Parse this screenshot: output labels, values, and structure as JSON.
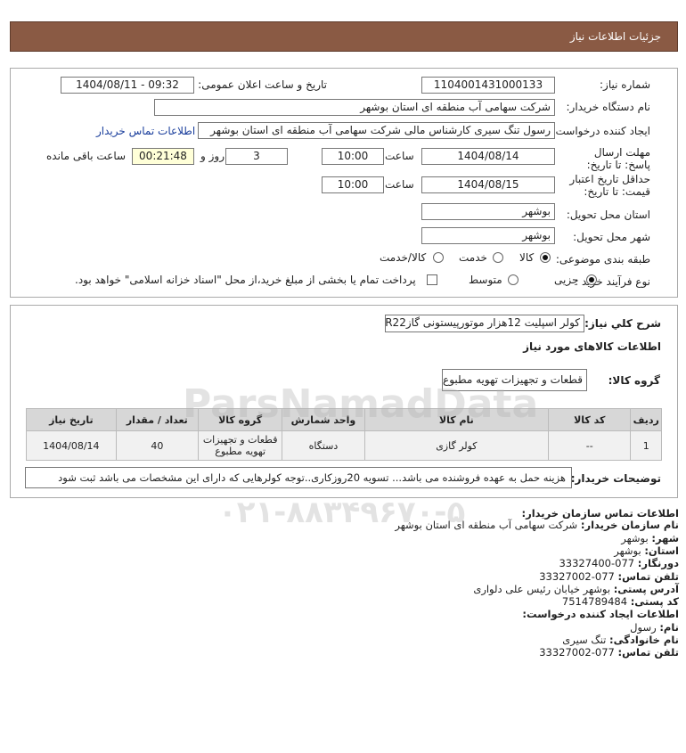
{
  "header": {
    "title": "جزئیات اطلاعات نیاز"
  },
  "fields": {
    "need_number_label": "شماره نیاز:",
    "need_number": "1104001431000133",
    "announce_label": "تاریخ و ساعت اعلان عمومی:",
    "announce_value": "1404/08/11 - 09:32",
    "buyer_org_label": "نام دستگاه خریدار:",
    "buyer_org": "شرکت سهامی آب منطقه ای استان بوشهر",
    "creator_label": "ایجاد کننده درخواست:",
    "creator": "رسول تنگ سیری کارشناس مالی شرکت سهامی آب منطقه ای استان بوشهر",
    "buyer_contact_link": "اطلاعات تماس خریدار",
    "deadline_label": "مهلت ارسال پاسخ: تا تاریخ:",
    "deadline_date": "1404/08/14",
    "time_label": "ساعت",
    "deadline_time": "10:00",
    "days_value": "3",
    "days_label": "روز و",
    "remaining_time": "00:21:48",
    "remaining_label": "ساعت باقی مانده",
    "validity_label": "حداقل تاریخ اعتبار قیمت: تا تاریخ:",
    "validity_date": "1404/08/15",
    "validity_time_label": "ساعت",
    "validity_time": "10:00",
    "delivery_province_label": "استان محل تحویل:",
    "delivery_province": "بوشهر",
    "delivery_city_label": "شهر محل تحویل:",
    "delivery_city": "بوشهر",
    "category_label": "طبقه بندی موضوعی:",
    "category_options": [
      "کالا",
      "خدمت",
      "کالا/خدمت"
    ],
    "process_label": "نوع فرآیند خرید :",
    "process_options": [
      "جزیی",
      "متوسط"
    ],
    "payment_note": "پرداخت تمام یا بخشی از مبلغ خرید،از محل \"اسناد خزانه اسلامی\" خواهد بود."
  },
  "need": {
    "desc_label": "شرح کلي نياز:",
    "desc": "کولر اسپلیت 12هزار موتورپیستونی گازR22",
    "goods_info_label": "اطلاعات کالاهای مورد نیاز",
    "group_label": "گروه کالا:",
    "group_value": "قطعات و تجهیزات تهویه مطبوع"
  },
  "table": {
    "headers": [
      "ردیف",
      "کد کالا",
      "نام کالا",
      "واحد شمارش",
      "گروه کالا",
      "تعداد / مقدار",
      "تاریخ نیاز"
    ],
    "rows": [
      {
        "row": "1",
        "code": "--",
        "name": "کولر گازی",
        "unit": "دستگاه",
        "group": "قطعات و تجهیزات تهویه مطبوع",
        "qty": "40",
        "date": "1404/08/14"
      }
    ]
  },
  "buyer_notes": {
    "label": "توضیحات خریدار:",
    "text": "هزینه حمل به عهده فروشنده می باشد... تسویه 20روزکاری..توجه کولرهایی که دارای این مشخصات می باشد ثبت شود"
  },
  "contact": {
    "title": "اطلاعات تماس سازمان خریدار:",
    "org_label": "نام سازمان خریدار:",
    "org": "شرکت سهامی آب منطقه ای استان بوشهر",
    "city_label": "شهر:",
    "city": "بوشهر",
    "province_label": "استان:",
    "province": "بوشهر",
    "fax_label": "دورنگار:",
    "fax": "077-33327400",
    "phone_label": "تلفن تماس:",
    "phone": "077-33327002",
    "address_label": "آدرس پستی:",
    "address": "بوشهر خیابان رئیس علی دلواری",
    "postal_label": "کد پستی:",
    "postal": "7514789484",
    "creator_title": "اطلاعات ایجاد کننده درخواست:",
    "name_label": "نام:",
    "name": "رسول",
    "family_label": "نام خانوادگی:",
    "family": "تنگ سیری",
    "creator_phone_label": "تلفن تماس:",
    "creator_phone": "077-33327002"
  },
  "watermark": {
    "brand": "ParsNamadData",
    "phone": "۰۲۱-۸۸۳۴۹۶۷۰-۵"
  },
  "colors": {
    "titlebar": "#8a5a44",
    "link": "#1a3e9c",
    "timer_bg": "#ffffd8",
    "table_header": "#d7d7d7"
  }
}
